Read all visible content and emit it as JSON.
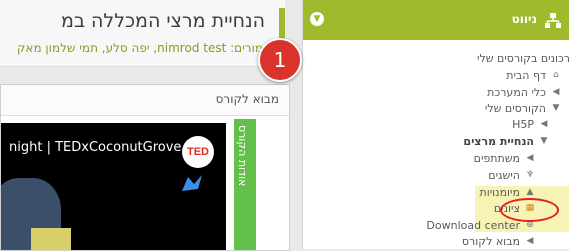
{
  "course": {
    "title": "הנחיית מרצי המכללה במ",
    "teachers": "מורים: nimrod test, יפה סלע, תמי שלמון מאק"
  },
  "badge": {
    "number": "1",
    "color": "#d9332b"
  },
  "video_panel": {
    "header": "מבוא לקורס",
    "video_title": "night | TEDxCoconutGrove",
    "ted_logo": "TED",
    "side_tab": "אודות הקורס"
  },
  "navigation": {
    "title": "ניווט",
    "accent_color": "#9fbb2d",
    "items": [
      {
        "label": "רכונים בקורסים שלי",
        "icon": ""
      },
      {
        "label": "דף הבית",
        "icon": "home-icon"
      },
      {
        "label": "כלי המערכת",
        "icon": "chevron-left-icon"
      },
      {
        "label": "הקורסים שלי",
        "icon": "chevron-down-icon"
      },
      {
        "label": "H5P",
        "icon": "chevron-left-icon"
      },
      {
        "label": "הנחיית מרצים",
        "icon": "chevron-down-icon"
      },
      {
        "label": "משתתפים",
        "icon": "chevron-left-icon"
      },
      {
        "label": "הישגים",
        "icon": "trophy-icon"
      },
      {
        "label": "מיומנויות",
        "icon": "skills-icon"
      },
      {
        "label": "ציונים",
        "icon": "grades-table-icon"
      },
      {
        "label": "Download center",
        "icon": "download-icon"
      },
      {
        "label": "מבוא לקורס",
        "icon": "chevron-left-icon"
      }
    ]
  }
}
